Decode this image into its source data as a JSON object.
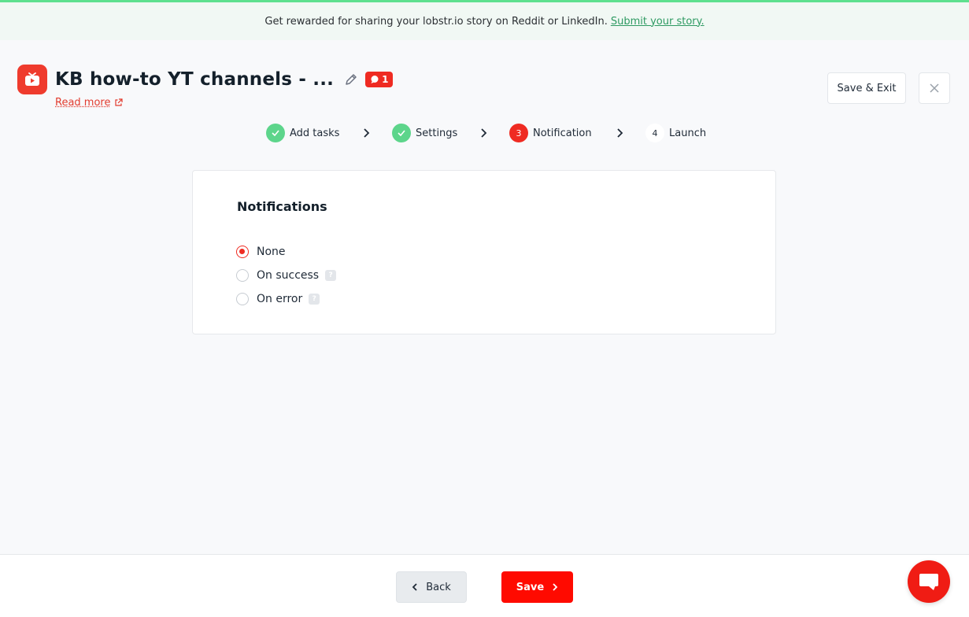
{
  "banner": {
    "text": "Get rewarded for sharing your lobstr.io story on Reddit or LinkedIn.",
    "link_label": "Submit your story."
  },
  "header": {
    "title": "KB how-to YT channels - ...",
    "badge_count": "1",
    "read_more_label": "Read more",
    "save_exit_label": "Save & Exit"
  },
  "stepper": {
    "steps": [
      {
        "number": "1",
        "label": "Add tasks",
        "state": "done"
      },
      {
        "number": "2",
        "label": "Settings",
        "state": "done"
      },
      {
        "number": "3",
        "label": "Notification",
        "state": "current"
      },
      {
        "number": "4",
        "label": "Launch",
        "state": "pending"
      }
    ]
  },
  "notifications": {
    "title": "Notifications",
    "options": [
      {
        "label": "None",
        "selected": true,
        "has_help": false
      },
      {
        "label": "On success",
        "selected": false,
        "has_help": true
      },
      {
        "label": "On error",
        "selected": false,
        "has_help": true
      }
    ]
  },
  "footer": {
    "back_label": "Back",
    "save_label": "Save"
  },
  "colors": {
    "brand_red": "#ef2b22",
    "done_green": "#5dd58b",
    "banner_bg": "#f1f8f4"
  }
}
